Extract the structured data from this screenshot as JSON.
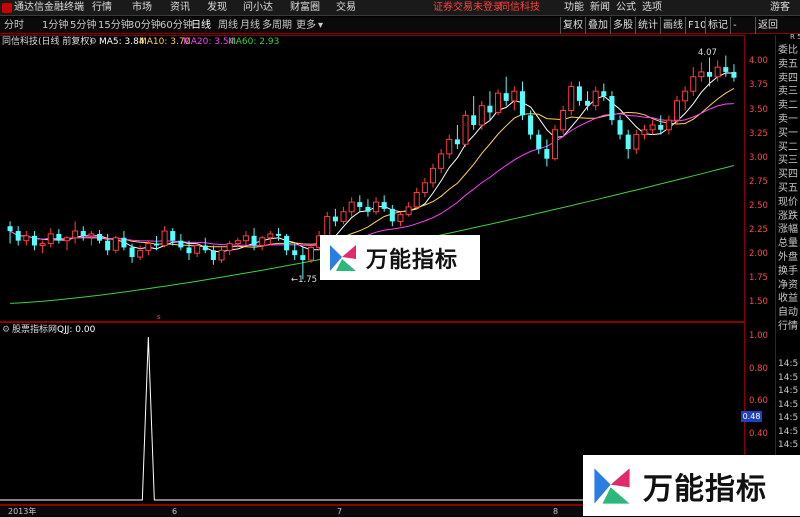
{
  "topbar": {
    "app_title": "通达信金融终端",
    "menus": [
      "行情",
      "市场",
      "资讯",
      "发现",
      "问小达",
      "财富圈",
      "交易"
    ],
    "status": [
      "证券交易未登录",
      "同信科技"
    ],
    "right_menus": [
      "功能",
      "新闻",
      "公式",
      "选项"
    ],
    "user": "游客"
  },
  "toolbar": {
    "periods": [
      "分时",
      "1分钟",
      "5分钟",
      "15分钟",
      "30分钟",
      "60分钟",
      "日线",
      "周线",
      "月线",
      "多周期",
      "更多"
    ],
    "selected_period": "日线",
    "right_tools": [
      "复权",
      "叠加",
      "多股",
      "统计",
      "画线",
      "F10",
      "标记",
      "-",
      "返回"
    ]
  },
  "info": {
    "stock": "同信科技(日线 前复权)",
    "ma5_label": "MA5: 3.84",
    "ma10_label": "MA10: 3.70",
    "ma20_label": "MA20: 3.54",
    "ma60_label": "MA60: 2.93",
    "ma5_color": "#ffffff",
    "ma10_color": "#ffd24a",
    "ma20_color": "#ff40ff",
    "ma60_color": "#40d040"
  },
  "subchart": {
    "indicator": "股票指标网",
    "value_label": "QJJ: 0.00",
    "cursor_value": "0.48"
  },
  "annotations": {
    "high": "4.07",
    "low": "←1.75"
  },
  "price_axis": [
    "4.00",
    "3.75",
    "3.50",
    "3.25",
    "3.00",
    "2.75",
    "2.50",
    "2.25",
    "2.00",
    "1.75",
    "1.50"
  ],
  "sub_axis": [
    "1.00",
    "0.80",
    "0.60",
    "0.40",
    "0.20"
  ],
  "side_panel": {
    "top": "R 500",
    "items": [
      "委比",
      "卖五",
      "卖四",
      "卖三",
      "卖二",
      "卖一",
      "买一",
      "买二",
      "买三",
      "买四",
      "买五",
      "现价",
      "涨跌",
      "涨幅",
      "总量",
      "外盘",
      "换手",
      "净资",
      "收益",
      "自动",
      "行情"
    ],
    "times": [
      "14:5",
      "14:5",
      "14:5",
      "14:5",
      "14:5",
      "14:5",
      "14:5"
    ]
  },
  "bottom_axis": [
    "2013年",
    "6",
    "7",
    "8",
    "9"
  ],
  "watermark": {
    "text": "万能指标"
  },
  "chart_data": {
    "type": "candlestick",
    "ylim": [
      1.4,
      4.2
    ],
    "candles": [
      [
        2.3,
        2.35,
        2.12,
        2.25
      ],
      [
        2.25,
        2.3,
        2.1,
        2.15
      ],
      [
        2.15,
        2.25,
        2.1,
        2.2
      ],
      [
        2.2,
        2.25,
        2.05,
        2.1
      ],
      [
        2.1,
        2.15,
        2.02,
        2.12
      ],
      [
        2.12,
        2.28,
        2.08,
        2.22
      ],
      [
        2.22,
        2.27,
        2.12,
        2.15
      ],
      [
        2.15,
        2.2,
        2.05,
        2.18
      ],
      [
        2.18,
        2.35,
        2.12,
        2.25
      ],
      [
        2.25,
        2.3,
        2.15,
        2.2
      ],
      [
        2.2,
        2.25,
        2.1,
        2.22
      ],
      [
        2.22,
        2.26,
        2.12,
        2.15
      ],
      [
        2.15,
        2.22,
        2.0,
        2.05
      ],
      [
        2.05,
        2.2,
        2.02,
        2.18
      ],
      [
        2.18,
        2.25,
        2.05,
        2.08
      ],
      [
        2.08,
        2.12,
        1.92,
        1.98
      ],
      [
        1.98,
        2.1,
        1.95,
        2.05
      ],
      [
        2.05,
        2.15,
        2.0,
        2.12
      ],
      [
        2.12,
        2.2,
        2.05,
        2.1
      ],
      [
        2.1,
        2.3,
        2.08,
        2.25
      ],
      [
        2.25,
        2.28,
        2.1,
        2.15
      ],
      [
        2.15,
        2.22,
        2.05,
        2.08
      ],
      [
        2.08,
        2.15,
        1.95,
        2.02
      ],
      [
        2.02,
        2.12,
        1.98,
        2.1
      ],
      [
        2.1,
        2.18,
        2.02,
        2.05
      ],
      [
        2.05,
        2.1,
        1.9,
        1.95
      ],
      [
        1.95,
        2.08,
        1.92,
        2.05
      ],
      [
        2.05,
        2.15,
        2.0,
        2.12
      ],
      [
        2.12,
        2.18,
        2.08,
        2.15
      ],
      [
        2.15,
        2.25,
        2.1,
        2.2
      ],
      [
        2.2,
        2.28,
        2.05,
        2.1
      ],
      [
        2.1,
        2.2,
        2.05,
        2.18
      ],
      [
        2.18,
        2.25,
        2.1,
        2.22
      ],
      [
        2.22,
        2.28,
        2.15,
        2.2
      ],
      [
        2.2,
        2.22,
        2.0,
        2.05
      ],
      [
        2.05,
        2.12,
        1.95,
        2.0
      ],
      [
        2.0,
        2.08,
        1.75,
        1.95
      ],
      [
        1.95,
        2.1,
        1.92,
        2.08
      ],
      [
        2.08,
        2.25,
        2.05,
        2.2
      ],
      [
        2.2,
        2.45,
        2.18,
        2.4
      ],
      [
        2.4,
        2.48,
        2.3,
        2.35
      ],
      [
        2.35,
        2.5,
        2.32,
        2.45
      ],
      [
        2.45,
        2.6,
        2.4,
        2.55
      ],
      [
        2.55,
        2.62,
        2.45,
        2.5
      ],
      [
        2.5,
        2.58,
        2.4,
        2.45
      ],
      [
        2.45,
        2.6,
        2.42,
        2.55
      ],
      [
        2.55,
        2.62,
        2.45,
        2.48
      ],
      [
        2.48,
        2.52,
        2.3,
        2.35
      ],
      [
        2.35,
        2.45,
        2.3,
        2.42
      ],
      [
        2.42,
        2.55,
        2.4,
        2.5
      ],
      [
        2.5,
        2.7,
        2.48,
        2.65
      ],
      [
        2.65,
        2.8,
        2.6,
        2.75
      ],
      [
        2.75,
        2.95,
        2.7,
        2.9
      ],
      [
        2.9,
        3.1,
        2.85,
        3.05
      ],
      [
        3.05,
        3.25,
        3.0,
        3.2
      ],
      [
        3.2,
        3.35,
        3.1,
        3.15
      ],
      [
        3.15,
        3.5,
        3.12,
        3.45
      ],
      [
        3.45,
        3.65,
        3.3,
        3.35
      ],
      [
        3.35,
        3.6,
        3.3,
        3.55
      ],
      [
        3.55,
        3.7,
        3.4,
        3.48
      ],
      [
        3.48,
        3.72,
        3.45,
        3.68
      ],
      [
        3.68,
        3.85,
        3.55,
        3.6
      ],
      [
        3.6,
        3.75,
        3.5,
        3.7
      ],
      [
        3.7,
        3.8,
        3.4,
        3.45
      ],
      [
        3.45,
        3.5,
        3.2,
        3.25
      ],
      [
        3.25,
        3.3,
        3.05,
        3.1
      ],
      [
        3.1,
        3.2,
        2.92,
        3.0
      ],
      [
        3.0,
        3.35,
        2.98,
        3.3
      ],
      [
        3.3,
        3.55,
        3.25,
        3.5
      ],
      [
        3.5,
        3.8,
        3.45,
        3.75
      ],
      [
        3.75,
        3.8,
        3.55,
        3.6
      ],
      [
        3.6,
        3.7,
        3.5,
        3.55
      ],
      [
        3.55,
        3.75,
        3.5,
        3.7
      ],
      [
        3.7,
        3.78,
        3.6,
        3.65
      ],
      [
        3.65,
        3.7,
        3.35,
        3.4
      ],
      [
        3.4,
        3.45,
        3.2,
        3.25
      ],
      [
        3.25,
        3.3,
        3.0,
        3.1
      ],
      [
        3.1,
        3.3,
        3.05,
        3.25
      ],
      [
        3.25,
        3.35,
        3.2,
        3.3
      ],
      [
        3.3,
        3.4,
        3.25,
        3.35
      ],
      [
        3.35,
        3.45,
        3.25,
        3.3
      ],
      [
        3.3,
        3.45,
        3.25,
        3.4
      ],
      [
        3.4,
        3.65,
        3.35,
        3.6
      ],
      [
        3.6,
        3.75,
        3.5,
        3.7
      ],
      [
        3.7,
        3.95,
        3.65,
        3.85
      ],
      [
        3.85,
        4.0,
        3.8,
        3.9
      ],
      [
        3.9,
        4.05,
        3.75,
        3.85
      ],
      [
        3.85,
        4.02,
        3.8,
        3.95
      ],
      [
        3.95,
        4.07,
        3.85,
        3.9
      ],
      [
        3.9,
        3.98,
        3.8,
        3.84
      ]
    ],
    "ma60_range": [
      1.5,
      2.93
    ],
    "sub_series": {
      "name": "QJJ",
      "spike_index": 17,
      "spike_value": 1.0
    }
  }
}
